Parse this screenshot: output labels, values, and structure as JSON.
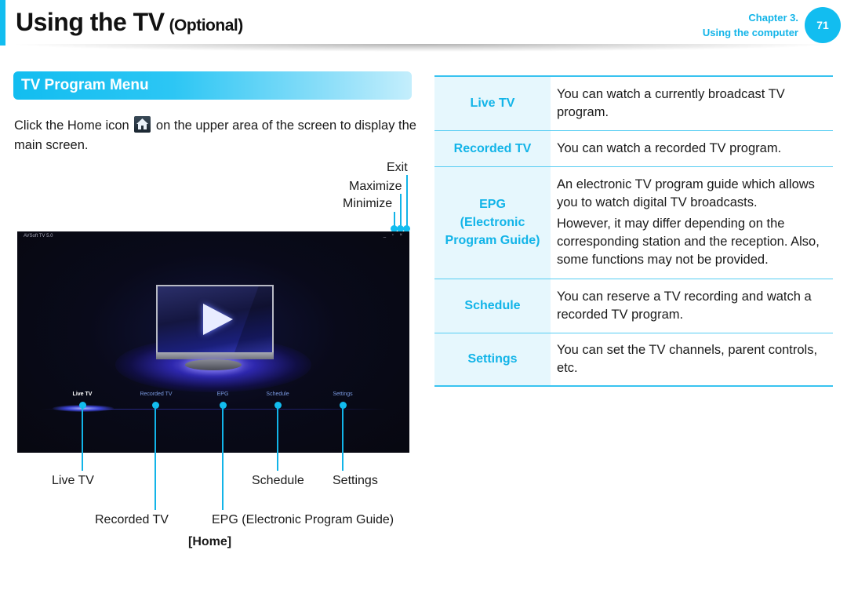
{
  "header": {
    "title": "Using the TV",
    "title_suffix": "(Optional)",
    "chapter_line1": "Chapter 3.",
    "chapter_line2": "Using the computer",
    "page_number": "71",
    "accent_color": "#12bdf0"
  },
  "section": {
    "title": "TV Program Menu",
    "intro_before_icon": "Click the Home icon",
    "intro_icon": "home-icon",
    "intro_after_icon": "on the upper area of the screen to display the main screen."
  },
  "figure": {
    "top_annotations": {
      "exit": "Exit",
      "maximize": "Maximize",
      "minimize": "Minimize"
    },
    "screenshot": {
      "app_name": "AVSoft TV 5.0",
      "window_controls": "_ ▫ ×",
      "menu_items": [
        {
          "label": "Live TV",
          "active": true
        },
        {
          "label": "Recorded TV",
          "active": false
        },
        {
          "label": "EPG",
          "active": false
        },
        {
          "label": "Schedule",
          "active": false
        },
        {
          "label": "Settings",
          "active": false
        }
      ]
    },
    "bottom_annotations": {
      "live_tv": "Live TV",
      "schedule": "Schedule",
      "settings": "Settings",
      "recorded_tv": "Recorded TV",
      "epg": "EPG (Electronic Program Guide)"
    },
    "caption": "[Home]"
  },
  "table": {
    "rows": [
      {
        "key": "Live TV",
        "desc": [
          "You can watch a currently broadcast TV program."
        ]
      },
      {
        "key": "Recorded TV",
        "desc": [
          "You can watch a recorded TV program."
        ]
      },
      {
        "key_line1": "EPG",
        "key_line2": "(Electronic",
        "key_line3": "Program Guide)",
        "desc": [
          "An electronic TV program guide which allows you to watch digital TV broadcasts.",
          "However, it may differ depending on the corresponding station and the reception. Also, some functions may not be provided."
        ]
      },
      {
        "key": "Schedule",
        "desc": [
          "You can reserve a TV recording and watch a recorded TV program."
        ]
      },
      {
        "key": "Settings",
        "desc": [
          "You can set the TV channels, parent controls, etc."
        ]
      }
    ]
  }
}
